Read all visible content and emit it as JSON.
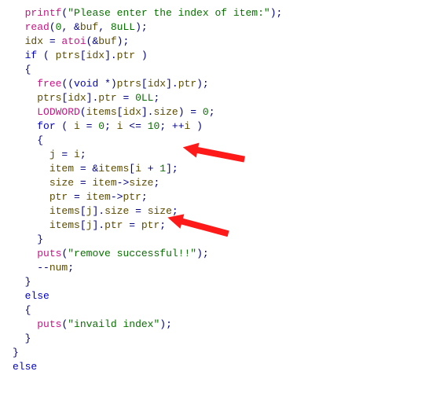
{
  "content": {
    "lines": [
      {
        "ind": 2,
        "tokens": [
          {
            "t": "printf",
            "c": "lib"
          },
          {
            "t": "(",
            "c": "punc"
          },
          {
            "t": "\"Please enter the index of item:\"",
            "c": "str"
          },
          {
            "t": ");",
            "c": "punc"
          }
        ]
      },
      {
        "ind": 2,
        "tokens": [
          {
            "t": "read",
            "c": "lib"
          },
          {
            "t": "(",
            "c": "punc"
          },
          {
            "t": "0",
            "c": "num"
          },
          {
            "t": ", &",
            "c": "punc"
          },
          {
            "t": "buf",
            "c": "var"
          },
          {
            "t": ", ",
            "c": "punc"
          },
          {
            "t": "8uLL",
            "c": "num"
          },
          {
            "t": ");",
            "c": "punc"
          }
        ]
      },
      {
        "ind": 2,
        "tokens": [
          {
            "t": "idx",
            "c": "var"
          },
          {
            "t": " = ",
            "c": "op"
          },
          {
            "t": "atoi",
            "c": "lib"
          },
          {
            "t": "(&",
            "c": "punc"
          },
          {
            "t": "buf",
            "c": "var"
          },
          {
            "t": ");",
            "c": "punc"
          }
        ]
      },
      {
        "ind": 2,
        "tokens": [
          {
            "t": "if",
            "c": "kw"
          },
          {
            "t": " ( ",
            "c": "punc"
          },
          {
            "t": "ptrs",
            "c": "var"
          },
          {
            "t": "[",
            "c": "punc"
          },
          {
            "t": "idx",
            "c": "var"
          },
          {
            "t": "].",
            "c": "punc"
          },
          {
            "t": "ptr",
            "c": "fld"
          },
          {
            "t": " )",
            "c": "punc"
          }
        ]
      },
      {
        "ind": 2,
        "tokens": [
          {
            "t": "{",
            "c": "punc"
          }
        ]
      },
      {
        "ind": 4,
        "tokens": [
          {
            "t": "free",
            "c": "lib"
          },
          {
            "t": "((",
            "c": "punc"
          },
          {
            "t": "void",
            "c": "type"
          },
          {
            "t": " *)",
            "c": "punc"
          },
          {
            "t": "ptrs",
            "c": "var"
          },
          {
            "t": "[",
            "c": "punc"
          },
          {
            "t": "idx",
            "c": "var"
          },
          {
            "t": "].",
            "c": "punc"
          },
          {
            "t": "ptr",
            "c": "fld"
          },
          {
            "t": ");",
            "c": "punc"
          }
        ]
      },
      {
        "ind": 4,
        "tokens": [
          {
            "t": "ptrs",
            "c": "var"
          },
          {
            "t": "[",
            "c": "punc"
          },
          {
            "t": "idx",
            "c": "var"
          },
          {
            "t": "].",
            "c": "punc"
          },
          {
            "t": "ptr",
            "c": "fld"
          },
          {
            "t": " = ",
            "c": "op"
          },
          {
            "t": "0LL",
            "c": "num"
          },
          {
            "t": ";",
            "c": "punc"
          }
        ]
      },
      {
        "ind": 4,
        "tokens": [
          {
            "t": "LODWORD",
            "c": "macro"
          },
          {
            "t": "(",
            "c": "punc"
          },
          {
            "t": "items",
            "c": "var"
          },
          {
            "t": "[",
            "c": "punc"
          },
          {
            "t": "idx",
            "c": "var"
          },
          {
            "t": "].",
            "c": "punc"
          },
          {
            "t": "size",
            "c": "fld"
          },
          {
            "t": ") = ",
            "c": "op"
          },
          {
            "t": "0",
            "c": "num"
          },
          {
            "t": ";",
            "c": "punc"
          }
        ]
      },
      {
        "ind": 4,
        "tokens": [
          {
            "t": "for",
            "c": "kw"
          },
          {
            "t": " ( ",
            "c": "punc"
          },
          {
            "t": "i",
            "c": "var"
          },
          {
            "t": " = ",
            "c": "op"
          },
          {
            "t": "0",
            "c": "num"
          },
          {
            "t": "; ",
            "c": "punc"
          },
          {
            "t": "i",
            "c": "var"
          },
          {
            "t": " <= ",
            "c": "op"
          },
          {
            "t": "10",
            "c": "num"
          },
          {
            "t": "; ++",
            "c": "punc"
          },
          {
            "t": "i",
            "c": "var"
          },
          {
            "t": " )",
            "c": "punc"
          }
        ]
      },
      {
        "ind": 4,
        "tokens": [
          {
            "t": "{",
            "c": "punc"
          }
        ]
      },
      {
        "ind": 6,
        "tokens": [
          {
            "t": "j",
            "c": "var"
          },
          {
            "t": " = ",
            "c": "op"
          },
          {
            "t": "i",
            "c": "var"
          },
          {
            "t": ";",
            "c": "punc"
          }
        ]
      },
      {
        "ind": 6,
        "tokens": [
          {
            "t": "item",
            "c": "var"
          },
          {
            "t": " = &",
            "c": "op"
          },
          {
            "t": "items",
            "c": "var"
          },
          {
            "t": "[",
            "c": "punc"
          },
          {
            "t": "i",
            "c": "var"
          },
          {
            "t": " + ",
            "c": "op"
          },
          {
            "t": "1",
            "c": "num"
          },
          {
            "t": "];",
            "c": "punc"
          }
        ]
      },
      {
        "ind": 6,
        "tokens": [
          {
            "t": "size",
            "c": "var"
          },
          {
            "t": " = ",
            "c": "op"
          },
          {
            "t": "item",
            "c": "var"
          },
          {
            "t": "->",
            "c": "op"
          },
          {
            "t": "size",
            "c": "fld"
          },
          {
            "t": ";",
            "c": "punc"
          }
        ]
      },
      {
        "ind": 6,
        "tokens": [
          {
            "t": "ptr",
            "c": "var"
          },
          {
            "t": " = ",
            "c": "op"
          },
          {
            "t": "item",
            "c": "var"
          },
          {
            "t": "->",
            "c": "op"
          },
          {
            "t": "ptr",
            "c": "fld"
          },
          {
            "t": ";",
            "c": "punc"
          }
        ]
      },
      {
        "ind": 6,
        "tokens": [
          {
            "t": "items",
            "c": "var"
          },
          {
            "t": "[",
            "c": "punc"
          },
          {
            "t": "j",
            "c": "var"
          },
          {
            "t": "].",
            "c": "punc"
          },
          {
            "t": "size",
            "c": "fld"
          },
          {
            "t": " = ",
            "c": "op"
          },
          {
            "t": "size",
            "c": "var"
          },
          {
            "t": ";",
            "c": "punc"
          }
        ]
      },
      {
        "ind": 6,
        "tokens": [
          {
            "t": "items",
            "c": "var"
          },
          {
            "t": "[",
            "c": "punc"
          },
          {
            "t": "j",
            "c": "var"
          },
          {
            "t": "].",
            "c": "punc"
          },
          {
            "t": "ptr",
            "c": "fld"
          },
          {
            "t": " = ",
            "c": "op"
          },
          {
            "t": "ptr",
            "c": "var"
          },
          {
            "t": ";",
            "c": "punc"
          }
        ]
      },
      {
        "ind": 4,
        "tokens": [
          {
            "t": "}",
            "c": "punc"
          }
        ]
      },
      {
        "ind": 4,
        "tokens": [
          {
            "t": "puts",
            "c": "lib"
          },
          {
            "t": "(",
            "c": "punc"
          },
          {
            "t": "\"remove successful!!\"",
            "c": "str"
          },
          {
            "t": ");",
            "c": "punc"
          }
        ]
      },
      {
        "ind": 4,
        "tokens": [
          {
            "t": "--",
            "c": "op"
          },
          {
            "t": "num",
            "c": "var"
          },
          {
            "t": ";",
            "c": "punc"
          }
        ]
      },
      {
        "ind": 2,
        "tokens": [
          {
            "t": "}",
            "c": "punc"
          }
        ]
      },
      {
        "ind": 2,
        "tokens": [
          {
            "t": "else",
            "c": "kw"
          }
        ]
      },
      {
        "ind": 2,
        "tokens": [
          {
            "t": "{",
            "c": "punc"
          }
        ]
      },
      {
        "ind": 4,
        "tokens": [
          {
            "t": "puts",
            "c": "lib"
          },
          {
            "t": "(",
            "c": "punc"
          },
          {
            "t": "\"invaild index\"",
            "c": "str"
          },
          {
            "t": ");",
            "c": "punc"
          }
        ]
      },
      {
        "ind": 2,
        "tokens": [
          {
            "t": "}",
            "c": "punc"
          }
        ]
      },
      {
        "ind": 0,
        "tokens": [
          {
            "t": "}",
            "c": "punc"
          }
        ]
      },
      {
        "ind": 0,
        "tokens": [
          {
            "t": "else",
            "c": "kw"
          }
        ]
      }
    ]
  },
  "annotations": {
    "arrow_color": "#ff1a1a"
  }
}
